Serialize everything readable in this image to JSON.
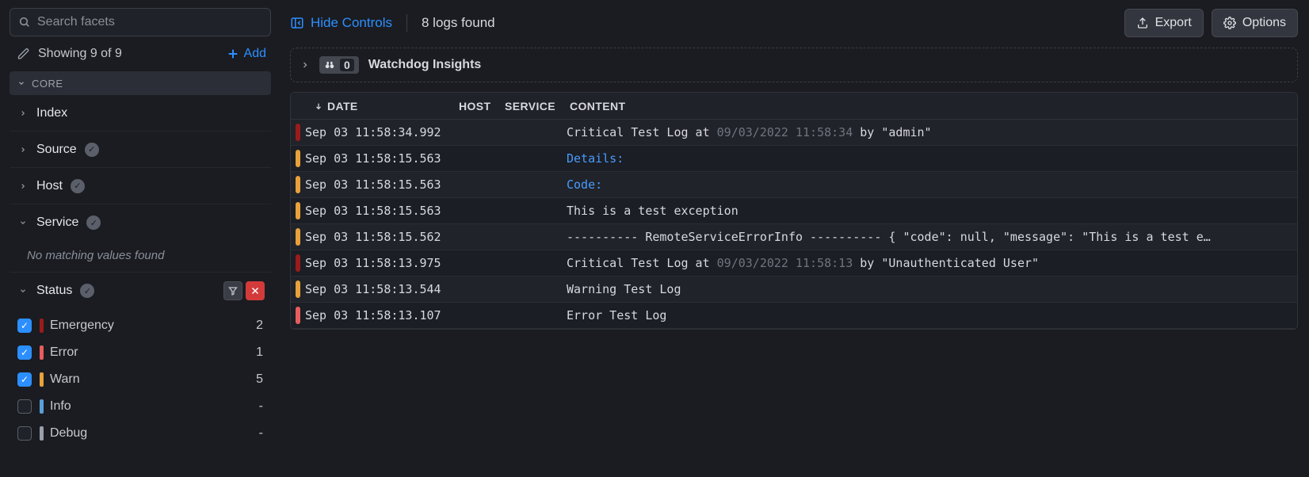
{
  "sidebar": {
    "search_placeholder": "Search facets",
    "showing_label": "Showing 9 of 9",
    "add_label": "Add",
    "core_label": "CORE",
    "no_match_label": "No matching values found",
    "facets": {
      "index": "Index",
      "source": "Source",
      "host": "Host",
      "service": "Service",
      "status": "Status"
    },
    "status_items": [
      {
        "label": "Emergency",
        "count": "2",
        "checked": true,
        "color": "emergency"
      },
      {
        "label": "Error",
        "count": "1",
        "checked": true,
        "color": "error"
      },
      {
        "label": "Warn",
        "count": "5",
        "checked": true,
        "color": "warn"
      },
      {
        "label": "Info",
        "count": "-",
        "checked": false,
        "color": "info"
      },
      {
        "label": "Debug",
        "count": "-",
        "checked": false,
        "color": "debug"
      }
    ]
  },
  "topbar": {
    "hide_controls": "Hide Controls",
    "logs_found": "8 logs found",
    "export": "Export",
    "options": "Options"
  },
  "insights": {
    "count": "0",
    "label": "Watchdog Insights"
  },
  "table": {
    "headers": {
      "date": "DATE",
      "host": "HOST",
      "service": "SERVICE",
      "content": "CONTENT"
    },
    "rows": [
      {
        "sev": "emergency",
        "date": "Sep 03 11:58:34.992",
        "content": [
          {
            "t": "Critical Test Log at ",
            "c": "plain"
          },
          {
            "t": "09/03/2022 11:58:34",
            "c": "muted"
          },
          {
            "t": " by \"admin\"",
            "c": "plain"
          }
        ]
      },
      {
        "sev": "warn",
        "date": "Sep 03 11:58:15.563",
        "content": [
          {
            "t": "Details:",
            "c": "link"
          }
        ]
      },
      {
        "sev": "warn",
        "date": "Sep 03 11:58:15.563",
        "content": [
          {
            "t": "Code:",
            "c": "link"
          }
        ]
      },
      {
        "sev": "warn",
        "date": "Sep 03 11:58:15.563",
        "content": [
          {
            "t": "This is a test exception",
            "c": "plain"
          }
        ]
      },
      {
        "sev": "warn",
        "date": "Sep 03 11:58:15.562",
        "content": [
          {
            "t": "---------- RemoteServiceErrorInfo ---------- { \"code\": null, \"message\": \"This is a test e…",
            "c": "plain"
          }
        ]
      },
      {
        "sev": "emergency",
        "date": "Sep 03 11:58:13.975",
        "content": [
          {
            "t": "Critical Test Log at ",
            "c": "plain"
          },
          {
            "t": "09/03/2022 11:58:13",
            "c": "muted"
          },
          {
            "t": " by \"Unauthenticated User\"",
            "c": "plain"
          }
        ]
      },
      {
        "sev": "warn",
        "date": "Sep 03 11:58:13.544",
        "content": [
          {
            "t": "Warning Test Log",
            "c": "plain"
          }
        ]
      },
      {
        "sev": "error",
        "date": "Sep 03 11:58:13.107",
        "content": [
          {
            "t": "Error Test Log",
            "c": "plain"
          }
        ]
      }
    ]
  }
}
